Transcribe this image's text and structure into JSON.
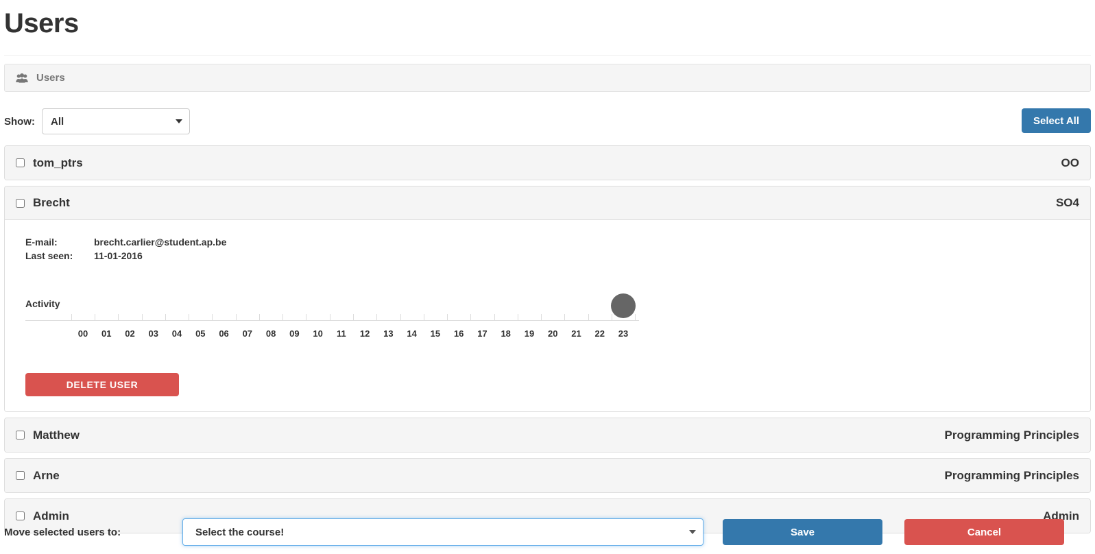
{
  "page": {
    "title": "Users"
  },
  "panel": {
    "icon": "users-icon",
    "label": "Users"
  },
  "filter": {
    "show_label": "Show:",
    "selected": "All",
    "options": [
      "All"
    ],
    "select_all_label": "Select All"
  },
  "colors": {
    "primary": "#3478ac",
    "danger": "#d9534f",
    "panel_head": "#f5f5f5",
    "focus_border": "#66afe9",
    "bubble": "#666666"
  },
  "users": [
    {
      "name": "tom_ptrs",
      "course": "OO",
      "checked": false,
      "expanded": false
    },
    {
      "name": "Brecht",
      "course": "SO4",
      "checked": false,
      "expanded": true,
      "details": {
        "email_label": "E-mail:",
        "email_value": "brecht.carlier@student.ap.be",
        "last_seen_label": "Last seen:",
        "last_seen_value": "11-01-2016",
        "activity_label": "Activity",
        "delete_label": "DELETE USER"
      }
    },
    {
      "name": "Matthew",
      "course": "Programming Principles",
      "checked": false,
      "expanded": false
    },
    {
      "name": "Arne",
      "course": "Programming Principles",
      "checked": false,
      "expanded": false
    },
    {
      "name": "Admin",
      "course": "Admin",
      "checked": false,
      "expanded": false
    }
  ],
  "chart_data": {
    "type": "scatter",
    "title": "Activity",
    "xlabel": "",
    "ylabel": "",
    "categories": [
      "00",
      "01",
      "02",
      "03",
      "04",
      "05",
      "06",
      "07",
      "08",
      "09",
      "10",
      "11",
      "12",
      "13",
      "14",
      "15",
      "16",
      "17",
      "18",
      "19",
      "20",
      "21",
      "22",
      "23"
    ],
    "values": [
      0,
      0,
      0,
      0,
      0,
      0,
      0,
      0,
      0,
      0,
      0,
      0,
      0,
      0,
      0,
      0,
      0,
      0,
      0,
      0,
      0,
      0,
      0,
      1
    ],
    "points": [
      {
        "x": "23",
        "size": 36,
        "color": "#666666"
      }
    ],
    "grid": false,
    "legend": "none"
  },
  "footer": {
    "move_label": "Move selected users to:",
    "course_select_value": "Select the course!",
    "course_options": [
      "Select the course!"
    ],
    "save_label": "Save",
    "cancel_label": "Cancel"
  }
}
